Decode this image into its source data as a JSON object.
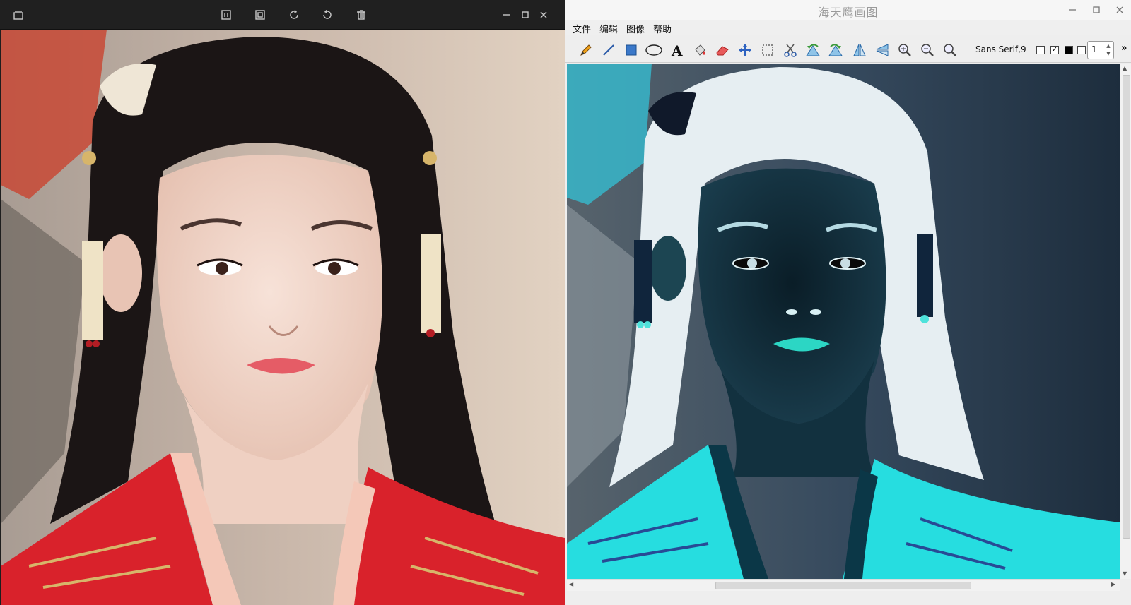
{
  "viewer": {
    "toolbar_icons": [
      "collection-icon",
      "fit-window-icon",
      "fullscreen-icon",
      "rotate-right-icon",
      "rotate-left-icon",
      "delete-icon"
    ],
    "window_controls": [
      "minimize-icon",
      "maximize-icon",
      "close-icon"
    ],
    "image": {
      "subject": "portrait",
      "colors": {
        "background": "#b8a79a",
        "hair": "#1a1414",
        "skin": "#f0d5c8",
        "lips": "#e9606a",
        "robe": "#d9222b",
        "robe_trim": "#f4c8b8",
        "gold": "#d7b56a"
      }
    }
  },
  "paint": {
    "title": "海天鹰画图",
    "window_controls": [
      "minimize-icon",
      "maximize-icon",
      "close-icon"
    ],
    "menu": [
      "文件",
      "编辑",
      "图像",
      "帮助"
    ],
    "tools": [
      "pencil-icon",
      "line-icon",
      "rectangle-icon",
      "ellipse-icon",
      "text-icon",
      "fill-icon",
      "eraser-icon",
      "move-icon",
      "select-icon",
      "cut-icon",
      "rotate-left-icon",
      "rotate-right-icon",
      "flip-horizontal-icon",
      "flip-vertical-icon",
      "zoom-in-icon",
      "zoom-out-icon",
      "zoom-reset-icon"
    ],
    "font": "Sans Serif,9",
    "fill_checkbox_checked": false,
    "outline_checkbox_checked": true,
    "stroke_width": "1",
    "overflow": "»",
    "image": {
      "subject": "portrait, color-inverted",
      "colors": {
        "background": "#3c5a73",
        "hair": "#e8eef2",
        "skin": "#0f2a38",
        "lips": "#29d2c0",
        "robe": "#26dde0",
        "edge_glow": "#d9f2f5"
      }
    }
  }
}
